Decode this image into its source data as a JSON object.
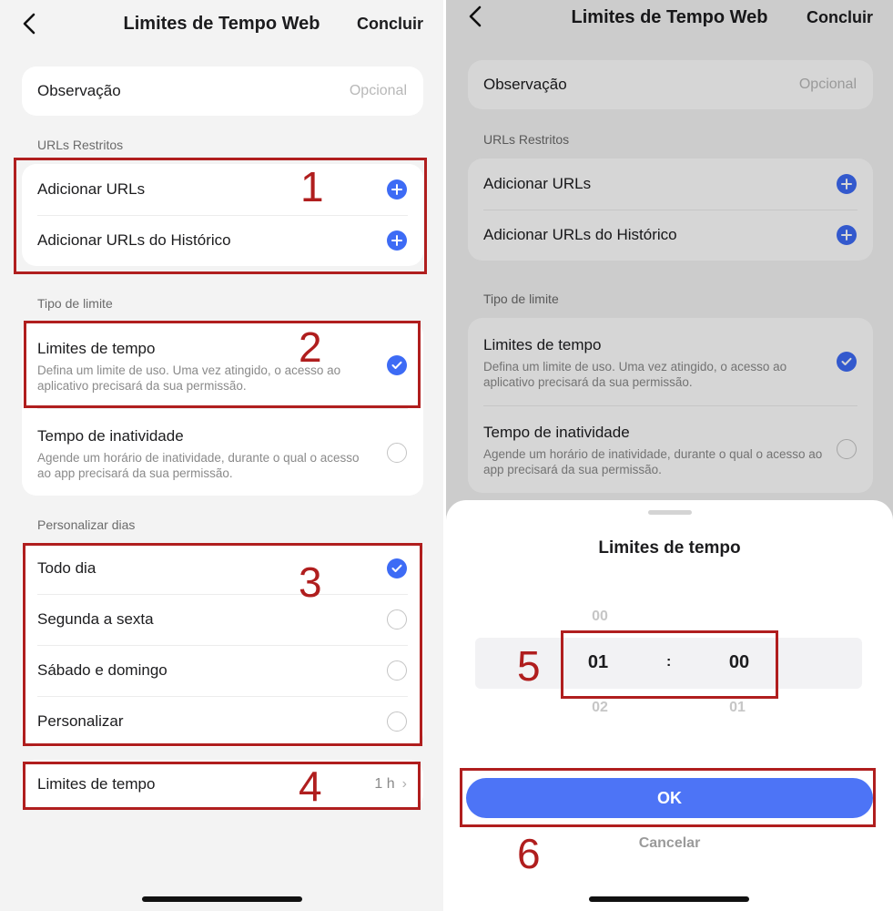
{
  "nav": {
    "title": "Limites de Tempo Web",
    "done": "Concluir"
  },
  "note": {
    "label": "Observação",
    "placeholder": "Opcional"
  },
  "urls_section": {
    "header": "URLs Restritos",
    "items": [
      {
        "label": "Adicionar URLs",
        "icon": "plus-circle-icon"
      },
      {
        "label": "Adicionar URLs do Histórico",
        "icon": "plus-circle-icon"
      }
    ]
  },
  "limit_type": {
    "header": "Tipo de limite",
    "options": [
      {
        "title": "Limites de tempo",
        "description": "Defina um limite de uso. Uma vez atingido, o acesso ao aplicativo precisará da sua permissão.",
        "selected": true
      },
      {
        "title": "Tempo de inatividade",
        "description": "Agende um horário de inatividade, durante o qual o acesso ao app precisará da sua permissão.",
        "selected": false
      }
    ]
  },
  "days": {
    "header": "Personalizar dias",
    "options": [
      {
        "label": "Todo dia",
        "selected": true
      },
      {
        "label": "Segunda a sexta",
        "selected": false
      },
      {
        "label": "Sábado e domingo",
        "selected": false
      },
      {
        "label": "Personalizar",
        "selected": false
      }
    ]
  },
  "time_limit_row": {
    "label": "Limites de tempo",
    "value": "1 h"
  },
  "sheet": {
    "title": "Limites de tempo",
    "picker": {
      "hours": {
        "prev": "00",
        "selected": "01",
        "next": "02"
      },
      "separator": ":",
      "minutes": {
        "prev": "",
        "selected": "00",
        "next": "01"
      }
    },
    "ok": "OK",
    "cancel": "Cancelar"
  },
  "annotations": [
    "1",
    "2",
    "3",
    "4",
    "5",
    "6"
  ],
  "colors": {
    "accent": "#3d6bf5",
    "annotation": "#b01e1e",
    "background": "#f3f3f3"
  }
}
